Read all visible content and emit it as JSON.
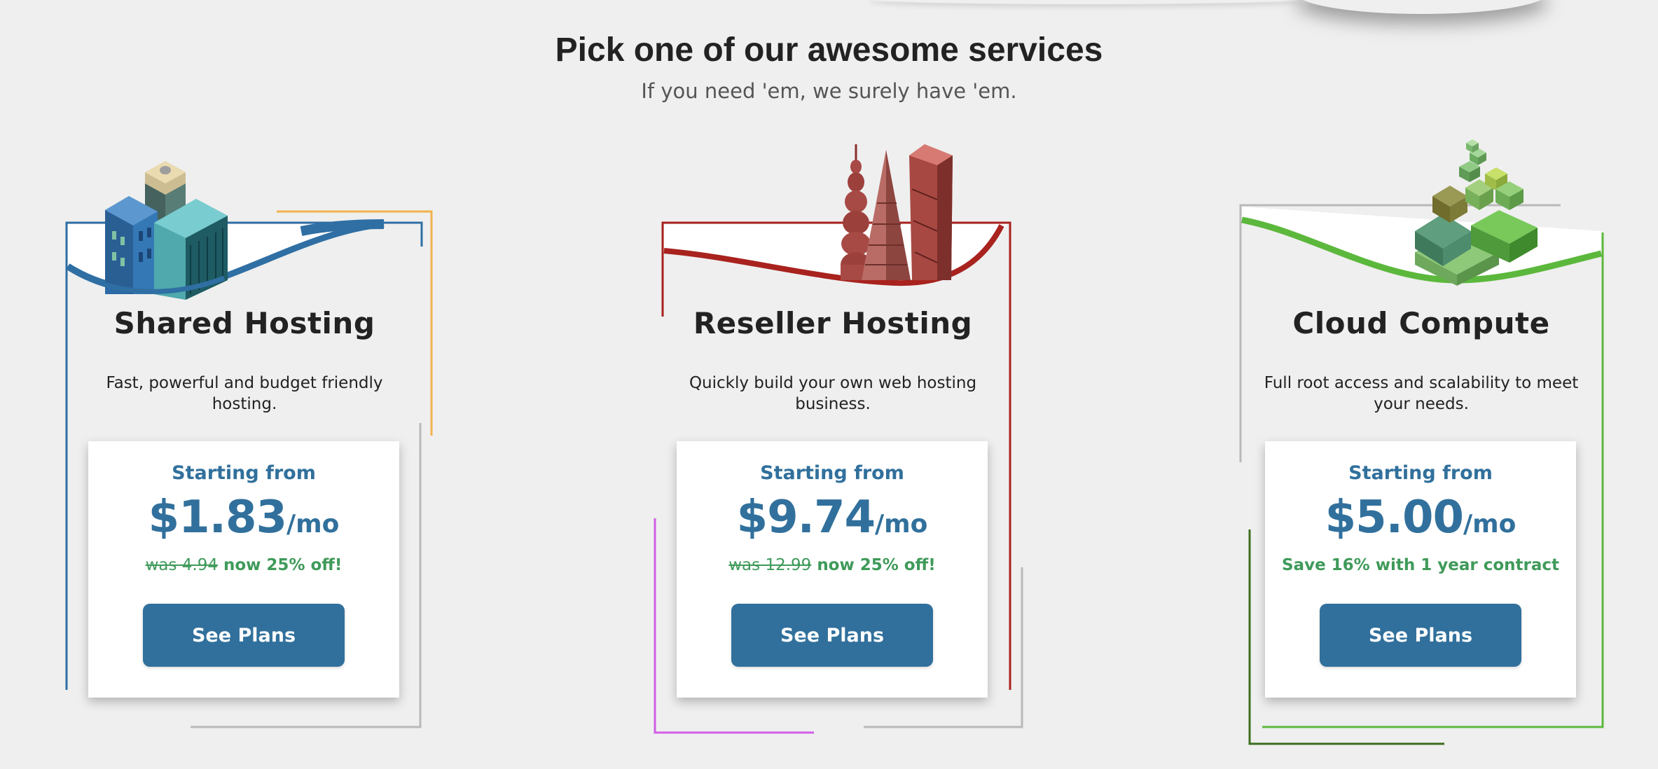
{
  "header": {
    "title": "Pick one of our awesome services",
    "subtitle": "If you need 'em, we surely have 'em."
  },
  "colors": {
    "primary": "#31709c",
    "deal_green": "#3f9a5a",
    "shared_accent": "#2f6fa4",
    "reseller_accent": "#a8221e",
    "cloud_accent": "#5cb83c"
  },
  "services": [
    {
      "title": "Shared Hosting",
      "description": "Fast, powerful and budget friendly hosting.",
      "starting_label": "Starting from",
      "price": "$1.83",
      "per": "/mo",
      "was": "was 4.94",
      "deal": "now 25% off!",
      "button": "See Plans",
      "icon": "buildings-icon"
    },
    {
      "title": "Reseller Hosting",
      "description": "Quickly build your own web hosting business.",
      "starting_label": "Starting from",
      "price": "$9.74",
      "per": "/mo",
      "was": "was 12.99",
      "deal": "now 25% off!",
      "button": "See Plans",
      "icon": "towers-icon"
    },
    {
      "title": "Cloud Compute",
      "description": "Full root access and scalability to meet your needs.",
      "starting_label": "Starting from",
      "price": "$5.00",
      "per": "/mo",
      "was": "",
      "deal": "Save 16% with 1 year contract",
      "button": "See Plans",
      "icon": "cubes-icon"
    }
  ]
}
